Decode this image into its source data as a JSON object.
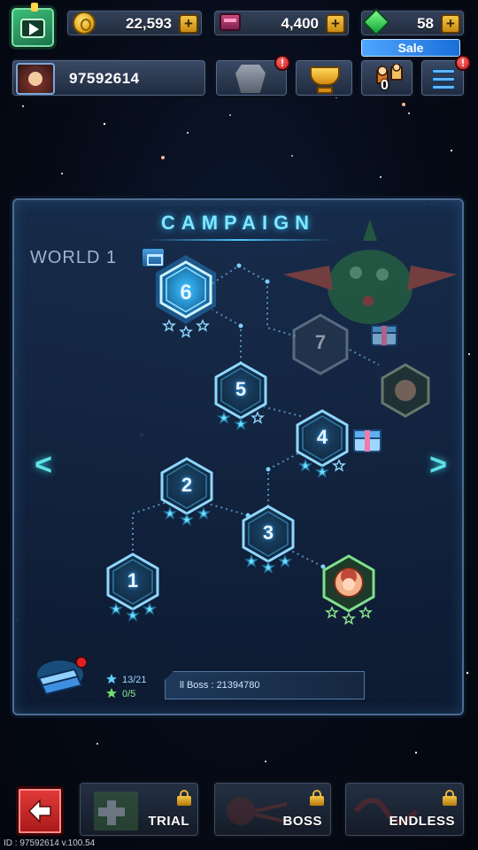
{
  "resources": {
    "gold": {
      "value": "22,593",
      "icon": "gold-coin-icon"
    },
    "crates": {
      "value": "4,400",
      "icon": "crate-icon"
    },
    "gems": {
      "value": "58",
      "icon": "gem-icon"
    },
    "plus_label": "+"
  },
  "sale_label": "Sale",
  "profile": {
    "player_id": "97592614"
  },
  "hero_count": "0",
  "notification_mark": "!",
  "campaign": {
    "title": "CAMPAIGN",
    "world_label": "WORLD 1",
    "stages": [
      {
        "number": "1",
        "stars": 3,
        "state": "cleared"
      },
      {
        "number": "2",
        "stars": 3,
        "state": "cleared"
      },
      {
        "number": "3",
        "stars": 3,
        "state": "cleared"
      },
      {
        "number": "4",
        "stars": 2,
        "state": "cleared"
      },
      {
        "number": "5",
        "stars": 2,
        "state": "cleared"
      },
      {
        "number": "6",
        "stars": 0,
        "state": "current"
      },
      {
        "number": "7",
        "stars": 0,
        "state": "locked"
      }
    ],
    "nav_prev": "<",
    "nav_next": ">",
    "star_progress": "13/21",
    "mission_progress": "0/5",
    "boss_label": "ll Boss : 21394780"
  },
  "modes": {
    "back_label": "back",
    "trial_label": "TRIAL",
    "boss_label": "BOSS",
    "endless_label": "ENDLESS"
  },
  "version_text": "ID : 97592614  v.100.54",
  "colors": {
    "accent_cyan": "#4fe0ff",
    "gold": "#f4c546",
    "back_red": "#d52b2b",
    "notification_red": "#e02020"
  }
}
